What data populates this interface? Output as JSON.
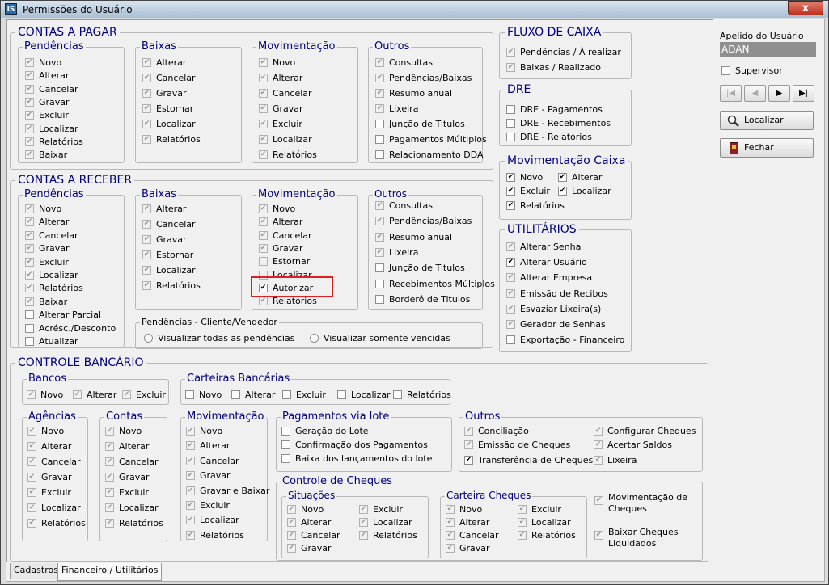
{
  "window": {
    "title": "Permissões do Usuário",
    "app_icon": "IS",
    "close": "x"
  },
  "cp": {
    "title": "CONTAS A PAGAR",
    "pend": {
      "title": "Pendências",
      "items": [
        {
          "l": "Novo",
          "c": true,
          "d": true
        },
        {
          "l": "Alterar",
          "c": true,
          "d": true
        },
        {
          "l": "Cancelar",
          "c": true,
          "d": true
        },
        {
          "l": "Gravar",
          "c": true,
          "d": true
        },
        {
          "l": "Excluir",
          "c": true,
          "d": true
        },
        {
          "l": "Localizar",
          "c": true,
          "d": true
        },
        {
          "l": "Relatórios",
          "c": true,
          "d": true
        },
        {
          "l": "Baixar",
          "c": true,
          "d": true
        }
      ]
    },
    "baixas": {
      "title": "Baixas",
      "items": [
        {
          "l": "Alterar",
          "c": true,
          "d": true
        },
        {
          "l": "Cancelar",
          "c": true,
          "d": true
        },
        {
          "l": "Gravar",
          "c": true,
          "d": true
        },
        {
          "l": "Estornar",
          "c": true,
          "d": true
        },
        {
          "l": "Localizar",
          "c": true,
          "d": true
        },
        {
          "l": "Relatórios",
          "c": true,
          "d": true
        }
      ]
    },
    "mov": {
      "title": "Movimentação",
      "items": [
        {
          "l": "Novo",
          "c": true,
          "d": true
        },
        {
          "l": "Alterar",
          "c": true,
          "d": true
        },
        {
          "l": "Cancelar",
          "c": true,
          "d": true
        },
        {
          "l": "Gravar",
          "c": true,
          "d": true
        },
        {
          "l": "Excluir",
          "c": true,
          "d": true
        },
        {
          "l": "Localizar",
          "c": true,
          "d": true
        },
        {
          "l": "Relatórios",
          "c": true,
          "d": true
        }
      ]
    },
    "outros": {
      "title": "Outros",
      "items": [
        {
          "l": "Consultas",
          "c": true,
          "d": true
        },
        {
          "l": "Pendências/Baixas",
          "c": true,
          "d": true
        },
        {
          "l": "Resumo anual",
          "c": true,
          "d": true
        },
        {
          "l": "Lixeira",
          "c": true,
          "d": true
        },
        {
          "l": "Junção de Titulos",
          "c": false,
          "d": false
        },
        {
          "l": "Pagamentos Múltiplos",
          "c": false,
          "d": false
        },
        {
          "l": "Relacionamento DDA",
          "c": false,
          "d": false
        }
      ]
    }
  },
  "cr": {
    "title": "CONTAS A RECEBER",
    "pend": {
      "title": "Pendências",
      "items": [
        {
          "l": "Novo",
          "c": true,
          "d": true
        },
        {
          "l": "Alterar",
          "c": true,
          "d": true
        },
        {
          "l": "Cancelar",
          "c": true,
          "d": true
        },
        {
          "l": "Gravar",
          "c": true,
          "d": true
        },
        {
          "l": "Excluir",
          "c": true,
          "d": true
        },
        {
          "l": "Localizar",
          "c": true,
          "d": true
        },
        {
          "l": "Relatórios",
          "c": true,
          "d": true
        },
        {
          "l": "Baixar",
          "c": true,
          "d": true
        },
        {
          "l": "Alterar Parcial",
          "c": false,
          "d": false
        },
        {
          "l": "Acrésc./Desconto",
          "c": false,
          "d": false
        },
        {
          "l": "Atualizar",
          "c": false,
          "d": false
        }
      ]
    },
    "baixas": {
      "title": "Baixas",
      "items": [
        {
          "l": "Alterar",
          "c": true,
          "d": true
        },
        {
          "l": "Cancelar",
          "c": true,
          "d": true
        },
        {
          "l": "Gravar",
          "c": true,
          "d": true
        },
        {
          "l": "Estornar",
          "c": true,
          "d": true
        },
        {
          "l": "Localizar",
          "c": true,
          "d": true
        },
        {
          "l": "Relatórios",
          "c": true,
          "d": true
        }
      ]
    },
    "mov": {
      "title": "Movimentação",
      "items": [
        {
          "l": "Novo",
          "c": true,
          "d": true
        },
        {
          "l": "Alterar",
          "c": true,
          "d": true
        },
        {
          "l": "Cancelar",
          "c": true,
          "d": true
        },
        {
          "l": "Gravar",
          "c": true,
          "d": true
        },
        {
          "l": "Estornar",
          "c": false,
          "d": true
        },
        {
          "l": "Localizar",
          "c": false,
          "d": true
        },
        {
          "l": "Autorizar",
          "c": true,
          "d": false
        },
        {
          "l": "Relatórios",
          "c": true,
          "d": true
        }
      ]
    },
    "outros": {
      "title": "Outros",
      "items": [
        {
          "l": "Consultas",
          "c": true,
          "d": true
        },
        {
          "l": "Pendências/Baixas",
          "c": true,
          "d": true
        },
        {
          "l": "Resumo anual",
          "c": true,
          "d": true
        },
        {
          "l": "Lixeira",
          "c": true,
          "d": true
        },
        {
          "l": "Junção de Titulos",
          "c": false,
          "d": false
        },
        {
          "l": "Recebimentos Múltiplos",
          "c": false,
          "d": false
        },
        {
          "l": "Borderô de Titulos",
          "c": false,
          "d": false
        }
      ]
    },
    "cliente": {
      "title": "Pendências - Cliente/Vendedor",
      "opt1": "Visualizar todas as pendências",
      "opt2": "Visualizar somente vencidas"
    }
  },
  "fluxo": {
    "title": "FLUXO DE CAIXA",
    "items": [
      {
        "l": "Pendências / À realizar",
        "c": true,
        "d": true
      },
      {
        "l": "Baixas / Realizado",
        "c": true,
        "d": true
      }
    ]
  },
  "dre": {
    "title": "DRE",
    "items": [
      {
        "l": "DRE - Pagamentos",
        "c": false,
        "d": false
      },
      {
        "l": "DRE - Recebimentos",
        "c": false,
        "d": false
      },
      {
        "l": "DRE - Relatórios",
        "c": false,
        "d": false
      }
    ]
  },
  "movcaixa": {
    "title": "Movimentação Caixa",
    "items": [
      {
        "l": "Novo",
        "c": true,
        "d": false
      },
      {
        "l": "Alterar",
        "c": true,
        "d": false
      },
      {
        "l": "Excluir",
        "c": true,
        "d": false
      },
      {
        "l": "Localizar",
        "c": true,
        "d": false
      },
      {
        "l": "Relatórios",
        "c": true,
        "d": false
      }
    ]
  },
  "util": {
    "title": "UTILITÁRIOS",
    "items": [
      {
        "l": "Alterar Senha",
        "c": true,
        "d": true
      },
      {
        "l": "Alterar Usuário",
        "c": true,
        "d": false
      },
      {
        "l": "Alterar Empresa",
        "c": true,
        "d": true
      },
      {
        "l": "Emissão de Recibos",
        "c": true,
        "d": true
      },
      {
        "l": "Esvaziar Lixeira(s)",
        "c": true,
        "d": true
      },
      {
        "l": "Gerador de Senhas",
        "c": true,
        "d": true
      },
      {
        "l": "Exportação - Financeiro",
        "c": false,
        "d": false
      }
    ]
  },
  "cb": {
    "title": "CONTROLE BANCÁRIO",
    "bancos": {
      "title": "Bancos",
      "items": [
        {
          "l": "Novo",
          "c": true,
          "d": true
        },
        {
          "l": "Alterar",
          "c": true,
          "d": true
        },
        {
          "l": "Excluir",
          "c": true,
          "d": true
        }
      ]
    },
    "carteiras": {
      "title": "Carteiras Bancárias",
      "items": [
        {
          "l": "Novo",
          "c": false,
          "d": false
        },
        {
          "l": "Alterar",
          "c": false,
          "d": false
        },
        {
          "l": "Excluir",
          "c": false,
          "d": false
        },
        {
          "l": "Localizar",
          "c": false,
          "d": false
        },
        {
          "l": "Relatórios",
          "c": false,
          "d": false
        }
      ]
    },
    "agencias": {
      "title": "Agências",
      "items": [
        {
          "l": "Novo",
          "c": true,
          "d": true
        },
        {
          "l": "Alterar",
          "c": true,
          "d": true
        },
        {
          "l": "Cancelar",
          "c": true,
          "d": true
        },
        {
          "l": "Gravar",
          "c": true,
          "d": true
        },
        {
          "l": "Excluir",
          "c": true,
          "d": true
        },
        {
          "l": "Localizar",
          "c": true,
          "d": true
        },
        {
          "l": "Relatórios",
          "c": true,
          "d": true
        }
      ]
    },
    "contas": {
      "title": "Contas",
      "items": [
        {
          "l": "Novo",
          "c": true,
          "d": true
        },
        {
          "l": "Alterar",
          "c": true,
          "d": true
        },
        {
          "l": "Cancelar",
          "c": true,
          "d": true
        },
        {
          "l": "Gravar",
          "c": true,
          "d": true
        },
        {
          "l": "Excluir",
          "c": true,
          "d": true
        },
        {
          "l": "Localizar",
          "c": true,
          "d": true
        },
        {
          "l": "Relatórios",
          "c": true,
          "d": true
        }
      ]
    },
    "mov": {
      "title": "Movimentação",
      "items": [
        {
          "l": "Novo",
          "c": true,
          "d": true
        },
        {
          "l": "Alterar",
          "c": true,
          "d": true
        },
        {
          "l": "Cancelar",
          "c": true,
          "d": true
        },
        {
          "l": "Gravar",
          "c": true,
          "d": true
        },
        {
          "l": "Gravar e Baixar",
          "c": true,
          "d": true
        },
        {
          "l": "Excluir",
          "c": true,
          "d": true
        },
        {
          "l": "Localizar",
          "c": true,
          "d": true
        },
        {
          "l": "Relatórios",
          "c": true,
          "d": true
        }
      ]
    },
    "lote": {
      "title": "Pagamentos via lote",
      "items": [
        {
          "l": "Geração do Lote",
          "c": false,
          "d": false
        },
        {
          "l": "Confirmação dos Pagamentos",
          "c": false,
          "d": false
        },
        {
          "l": "Baixa dos lançamentos do lote",
          "c": false,
          "d": false
        }
      ]
    },
    "outros": {
      "title": "Outros",
      "items": [
        {
          "l": "Conciliação",
          "c": true,
          "d": true
        },
        {
          "l": "Configurar Cheques",
          "c": true,
          "d": true
        },
        {
          "l": "Emissão de Cheques",
          "c": true,
          "d": true
        },
        {
          "l": "Acertar Saldos",
          "c": true,
          "d": true
        },
        {
          "l": "Transferência de Cheques",
          "c": true,
          "d": false
        },
        {
          "l": "Lixeira",
          "c": true,
          "d": true
        }
      ]
    },
    "cheques": {
      "title": "Controle de Cheques",
      "sit": {
        "title": "Situações",
        "items": [
          {
            "l": "Novo",
            "c": true,
            "d": true
          },
          {
            "l": "Excluir",
            "c": true,
            "d": true
          },
          {
            "l": "Alterar",
            "c": true,
            "d": true
          },
          {
            "l": "Localizar",
            "c": true,
            "d": true
          },
          {
            "l": "Cancelar",
            "c": true,
            "d": true
          },
          {
            "l": "Relatórios",
            "c": true,
            "d": true
          },
          {
            "l": "Gravar",
            "c": true,
            "d": true
          }
        ]
      },
      "cart": {
        "title": "Carteira Cheques",
        "items": [
          {
            "l": "Novo",
            "c": true,
            "d": true
          },
          {
            "l": "Excluir",
            "c": true,
            "d": true
          },
          {
            "l": "Alterar",
            "c": true,
            "d": true
          },
          {
            "l": "Localizar",
            "c": true,
            "d": true
          },
          {
            "l": "Cancelar",
            "c": true,
            "d": true
          },
          {
            "l": "Relatórios",
            "c": true,
            "d": true
          },
          {
            "l": "Gravar",
            "c": true,
            "d": true
          }
        ]
      },
      "mov": {
        "l1": "Movimentação de",
        "l2": "Cheques",
        "c": true,
        "d": true
      },
      "baixar": {
        "l1": "Baixar Cheques",
        "l2": "Liquidados",
        "c": true,
        "d": true
      }
    }
  },
  "right": {
    "apelido_label": "Apelido do Usuário",
    "apelido_value": "ADAN",
    "supervisor": "Supervisor",
    "nav": [
      "|◀",
      "◀",
      "▶",
      "▶|"
    ],
    "localizar": "Localizar",
    "fechar": "Fechar"
  },
  "tabs": [
    "Cadastros",
    "Financeiro / Utilitários"
  ],
  "colors": {
    "title": "#00007f",
    "highlight": "#e02020"
  }
}
